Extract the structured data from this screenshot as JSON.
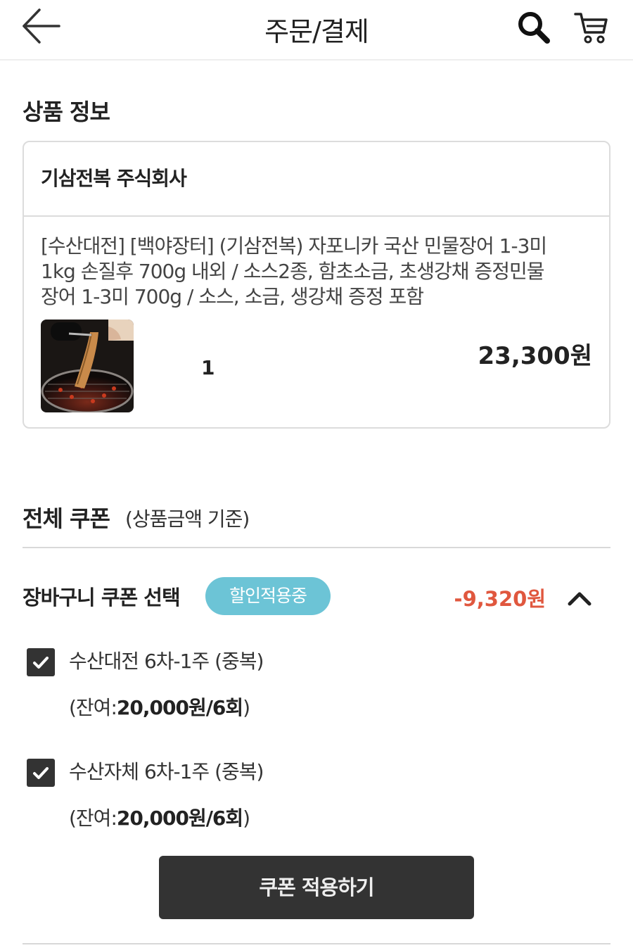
{
  "header": {
    "title": "주문/결제",
    "back_icon": "arrow-left-icon",
    "search_icon": "search-icon",
    "cart_icon": "cart-icon"
  },
  "product_section": {
    "title": "상품 정보",
    "seller": "기삼전복 주식회사",
    "description_lines": [
      "[수산대전] [백야장터] (기삼전복) 자포니카 국산 민물장어 1-3미",
      "1kg 손질후 700g 내외 / 소스2종, 함초소금, 초생강채 증정민물",
      "장어 1-3미 700g / 소스, 소금, 생강채 증정 포함"
    ],
    "quantity": "1",
    "price": "23,300원"
  },
  "coupon_section": {
    "title": "전체 쿠폰",
    "subtitle": "(상품금액 기준)",
    "cart_coupon_label": "장바구니 쿠폰 선택",
    "badge": "할인적용중",
    "discount": "-9,320원",
    "items": [
      {
        "name": "수산대전 6차-1주 (중복)",
        "remain_prefix": "(잔여:",
        "remain_value": "20,000원/6회",
        "remain_suffix": ")",
        "checked": true
      },
      {
        "name": "수산자체 6차-1주 (중복)",
        "remain_prefix": "(잔여:",
        "remain_value": "20,000원/6회",
        "remain_suffix": ")",
        "checked": true
      }
    ],
    "apply_button": "쿠폰 적용하기"
  },
  "colors": {
    "badge_bg": "#6cc4d6",
    "discount_text": "#e0573e",
    "button_bg": "#333333"
  }
}
